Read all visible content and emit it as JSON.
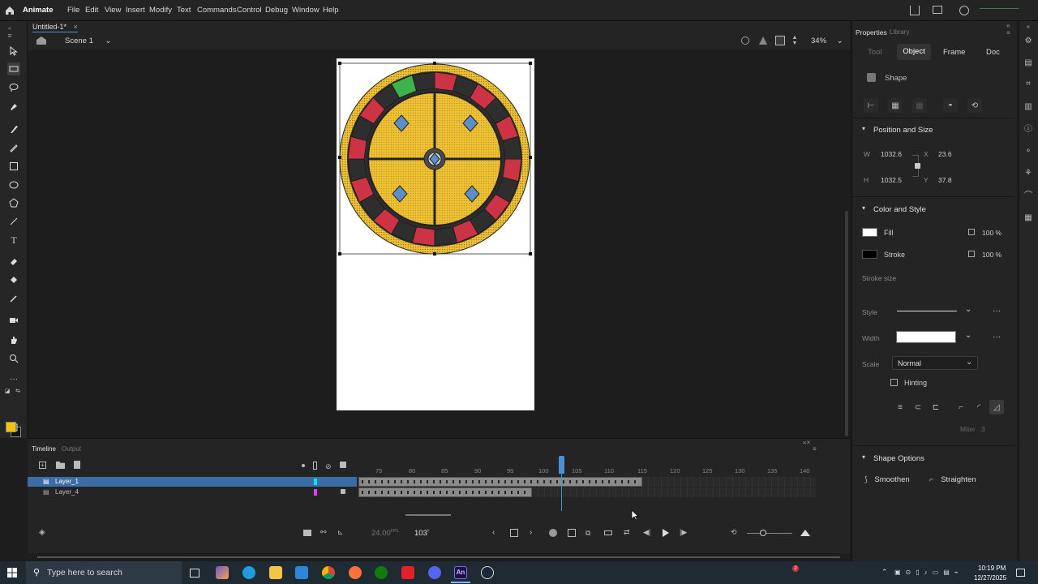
{
  "app": {
    "name": "Animate",
    "document_tab": "Untitled-1*"
  },
  "menu": [
    "File",
    "Edit",
    "View",
    "Insert",
    "Modify",
    "Text",
    "Commands",
    "Control",
    "Debug",
    "Window",
    "Help"
  ],
  "scene": {
    "label": "Scene 1",
    "zoom": "34%"
  },
  "properties": {
    "panel_tabs": [
      "Properties",
      "Library"
    ],
    "sub_tabs": [
      "Tool",
      "Object",
      "Frame",
      "Doc"
    ],
    "active_sub_tab": "Object",
    "object_type": "Shape",
    "position_size": {
      "title": "Position and Size",
      "w_label": "W",
      "w": "1032.6",
      "h_label": "H",
      "h": "1032.5",
      "x_label": "X",
      "x": "23.6",
      "y_label": "Y",
      "y": "37.8"
    },
    "color_style": {
      "title": "Color and Style",
      "fill_label": "Fill",
      "fill_opacity": "100 %",
      "stroke_label": "Stroke",
      "stroke_opacity": "100 %",
      "stroke_size_label": "Stroke size",
      "style_label": "Style",
      "width_label": "Width",
      "scale_label": "Scale",
      "scale_value": "Normal",
      "hinting_label": "Hinting",
      "miter_label": "Miter",
      "miter_value": "3"
    },
    "shape_options": {
      "title": "Shape Options",
      "smoothen": "Smoothen",
      "straighten": "Straighten"
    }
  },
  "timeline": {
    "tabs": [
      "Timeline",
      "Output"
    ],
    "ruler_labels": [
      "75",
      "80",
      "85",
      "90",
      "95",
      "100",
      "105",
      "110",
      "115",
      "120",
      "125",
      "130",
      "135",
      "140"
    ],
    "layers": [
      {
        "name": "Layer_1",
        "selected": true,
        "color": "#00e5ff"
      },
      {
        "name": "Layer_4",
        "selected": false,
        "color": "#e040fb"
      }
    ],
    "fps": "24.00",
    "fps_unit": "FPS",
    "current_frame": "103",
    "frame_unit": "F"
  },
  "colors": {
    "accent": "#4a90d9",
    "fill_swatch": "#f5c400",
    "wheel_yellow": "#f1c232",
    "wheel_red": "#cc3344"
  },
  "taskbar": {
    "search_placeholder": "Type here to search",
    "time": "10:19 PM",
    "date": "12/27/2025",
    "notification_badge": "2"
  }
}
